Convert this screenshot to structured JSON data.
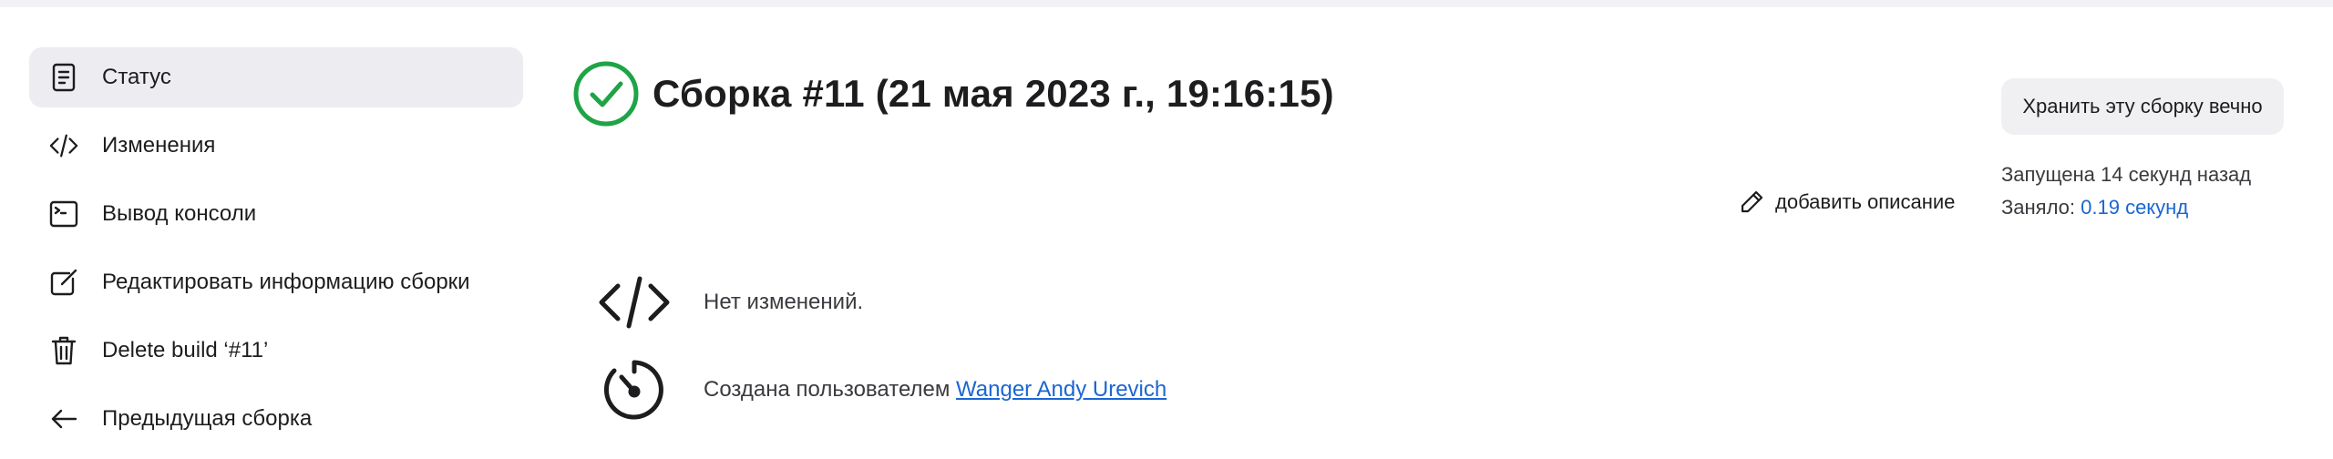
{
  "sidebar": {
    "items": [
      {
        "label": "Статус",
        "icon": "document-icon",
        "active": true
      },
      {
        "label": "Изменения",
        "icon": "code-icon"
      },
      {
        "label": "Вывод консоли",
        "icon": "terminal-icon"
      },
      {
        "label": "Редактировать информацию сборки",
        "icon": "edit-icon"
      },
      {
        "label": "Delete build ‘#11’",
        "icon": "trash-icon"
      },
      {
        "label": "Предыдущая сборка",
        "icon": "arrow-left-icon"
      }
    ]
  },
  "build": {
    "title": "Сборка #11 (21 мая 2023 г., 19:16:15)",
    "status_icon": "success-check-icon",
    "status_color": "#1ea446",
    "keep_button": "Хранить эту сборку вечно",
    "started": "Запущена 14 секунд назад",
    "took_label": "Заняло: ",
    "took_value": "0.19 секунд",
    "add_description": "добавить описание",
    "changes_text": "Нет изменений.",
    "created_by_text": "Создана пользователем ",
    "created_by_user": "Wanger Andy Urevich"
  },
  "colors": {
    "accent_link": "#1a66d1",
    "active_bg": "#ececf1"
  }
}
